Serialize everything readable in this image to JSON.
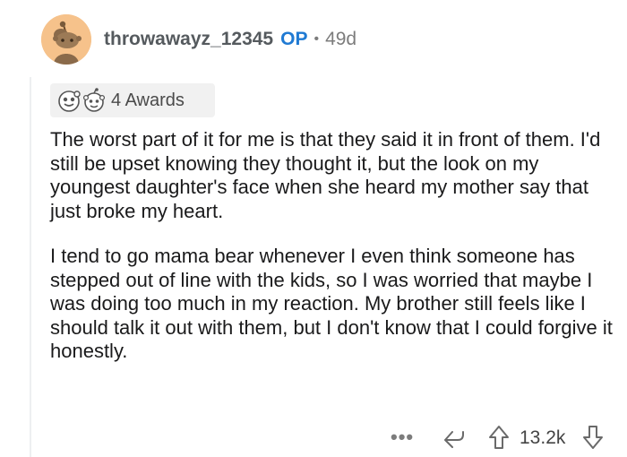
{
  "comment": {
    "username": "throwawayz_12345",
    "op_badge": "OP",
    "separator": "•",
    "age": "49d",
    "awards_label": "4 Awards",
    "paragraphs": [
      "The worst part of it for me is that they said it in front of them. I'd still be upset knowing they thought it, but the look on my youngest daughter's face when she heard my mother say that just broke my heart.",
      "I tend to go mama bear whenever I even think someone has stepped out of line with the kids, so I was worried that maybe I was doing too much in my reaction. My brother still feels like I should talk it out with them, but I don't know that I could forgive it honestly."
    ]
  },
  "footer": {
    "more_label": "•••",
    "score": "13.2k"
  },
  "icons": {
    "avatar": "snoo-avatar-icon",
    "award_1": "award-icon",
    "award_2": "award-icon",
    "more": "more-options-icon",
    "reply": "reply-icon",
    "upvote": "upvote-arrow-icon",
    "downvote": "downvote-arrow-icon"
  },
  "colors": {
    "op_badge": "#1f7ad3",
    "avatar_bg": "#f6c28b",
    "awards_bg": "#f1f1f1",
    "thread_line": "#edeff1"
  }
}
